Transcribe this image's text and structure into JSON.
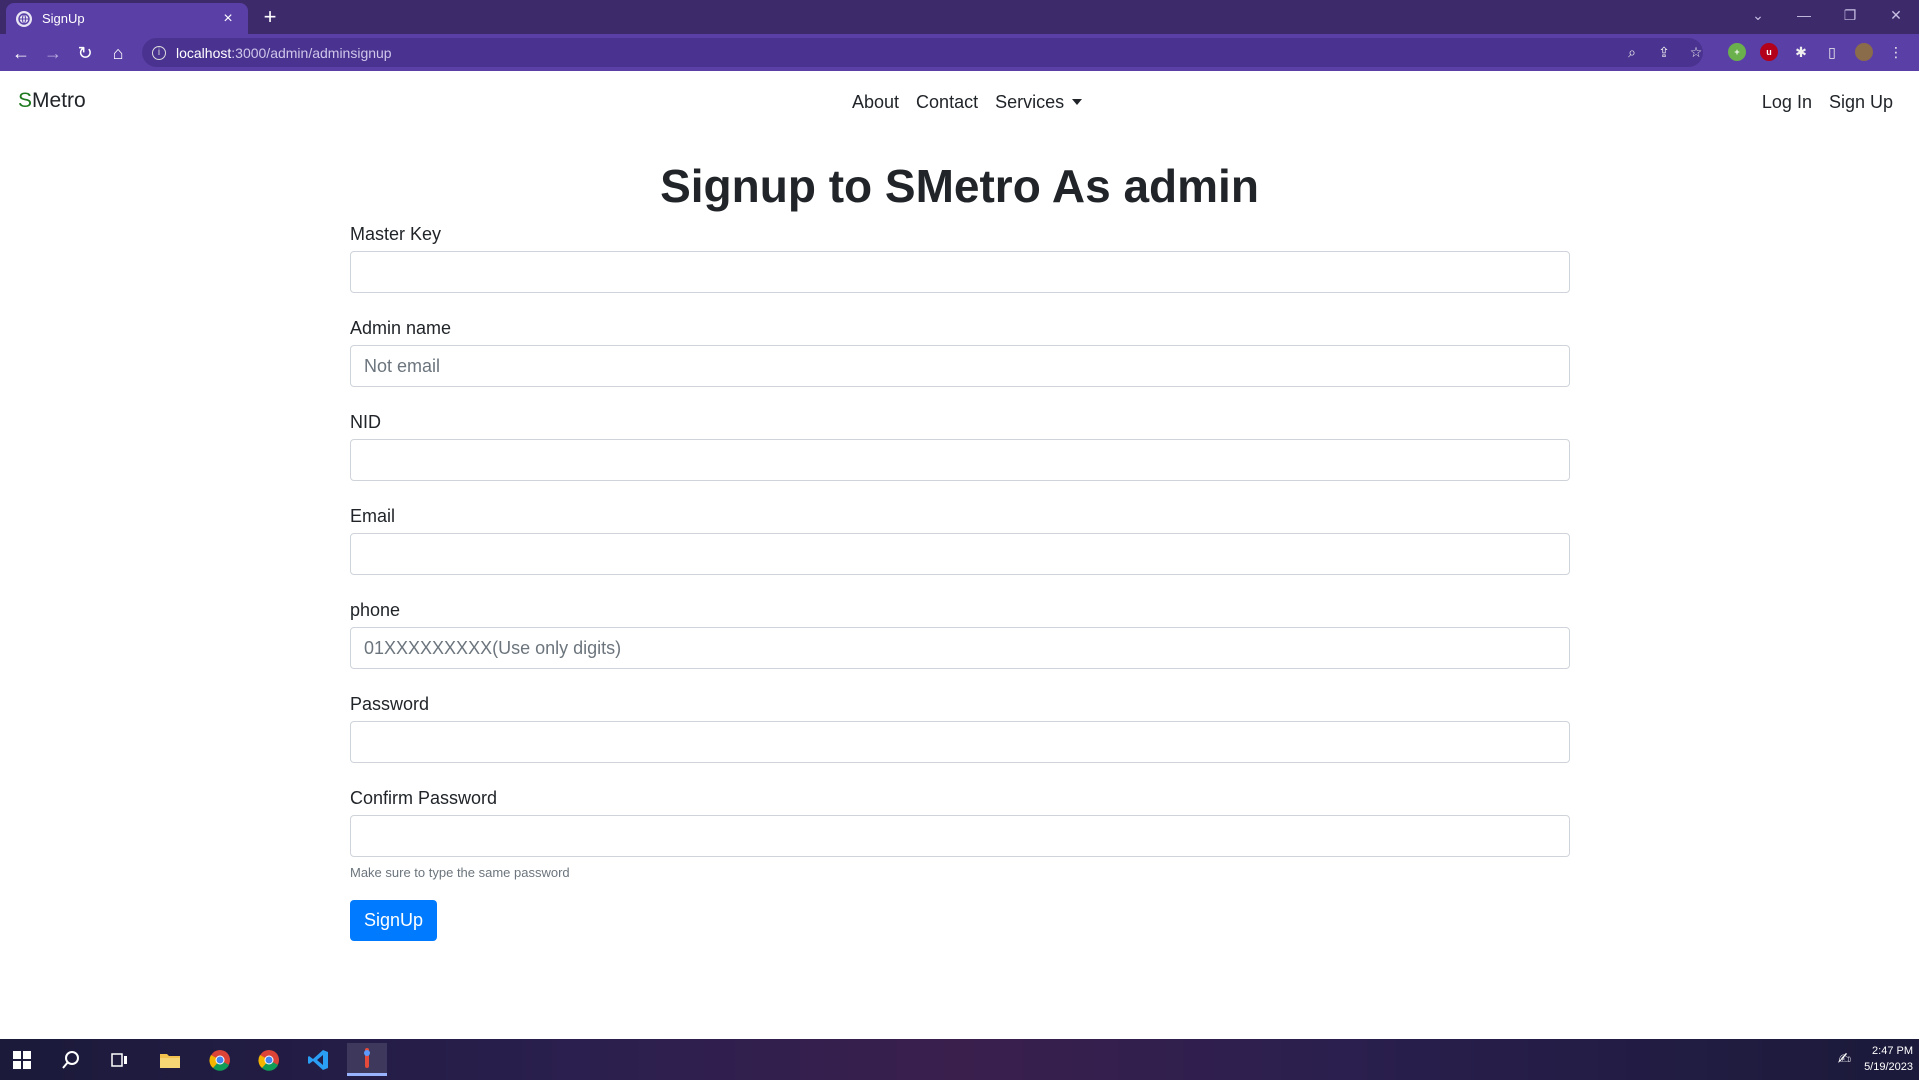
{
  "browser": {
    "tab_title": "SignUp",
    "tab_close": "×",
    "new_tab": "+",
    "url_host": "localhost",
    "url_path": ":3000/admin/adminsignup"
  },
  "navbar": {
    "brand_s": "S",
    "brand_rest": "Metro",
    "links": [
      "About",
      "Contact",
      "Services"
    ],
    "auth": [
      "Log In",
      "Sign Up"
    ]
  },
  "form": {
    "heading": "Signup to SMetro As admin",
    "fields": [
      {
        "label": "Master Key",
        "placeholder": ""
      },
      {
        "label": "Admin name",
        "placeholder": "Not email"
      },
      {
        "label": "NID",
        "placeholder": ""
      },
      {
        "label": "Email",
        "placeholder": ""
      },
      {
        "label": "phone",
        "placeholder": "01XXXXXXXXX(Use only digits)"
      },
      {
        "label": "Password",
        "placeholder": ""
      },
      {
        "label": "Confirm Password",
        "placeholder": ""
      }
    ],
    "hint": "Make sure to type the same password",
    "submit": "SignUp"
  },
  "taskbar": {
    "time": "2:47 PM",
    "date": "5/19/2023"
  },
  "colors": {
    "chrome_dark": "#3c2a6b",
    "chrome_tab": "#5a3fa6",
    "primary": "#007bff",
    "brand_green": "#1f7a1f"
  }
}
